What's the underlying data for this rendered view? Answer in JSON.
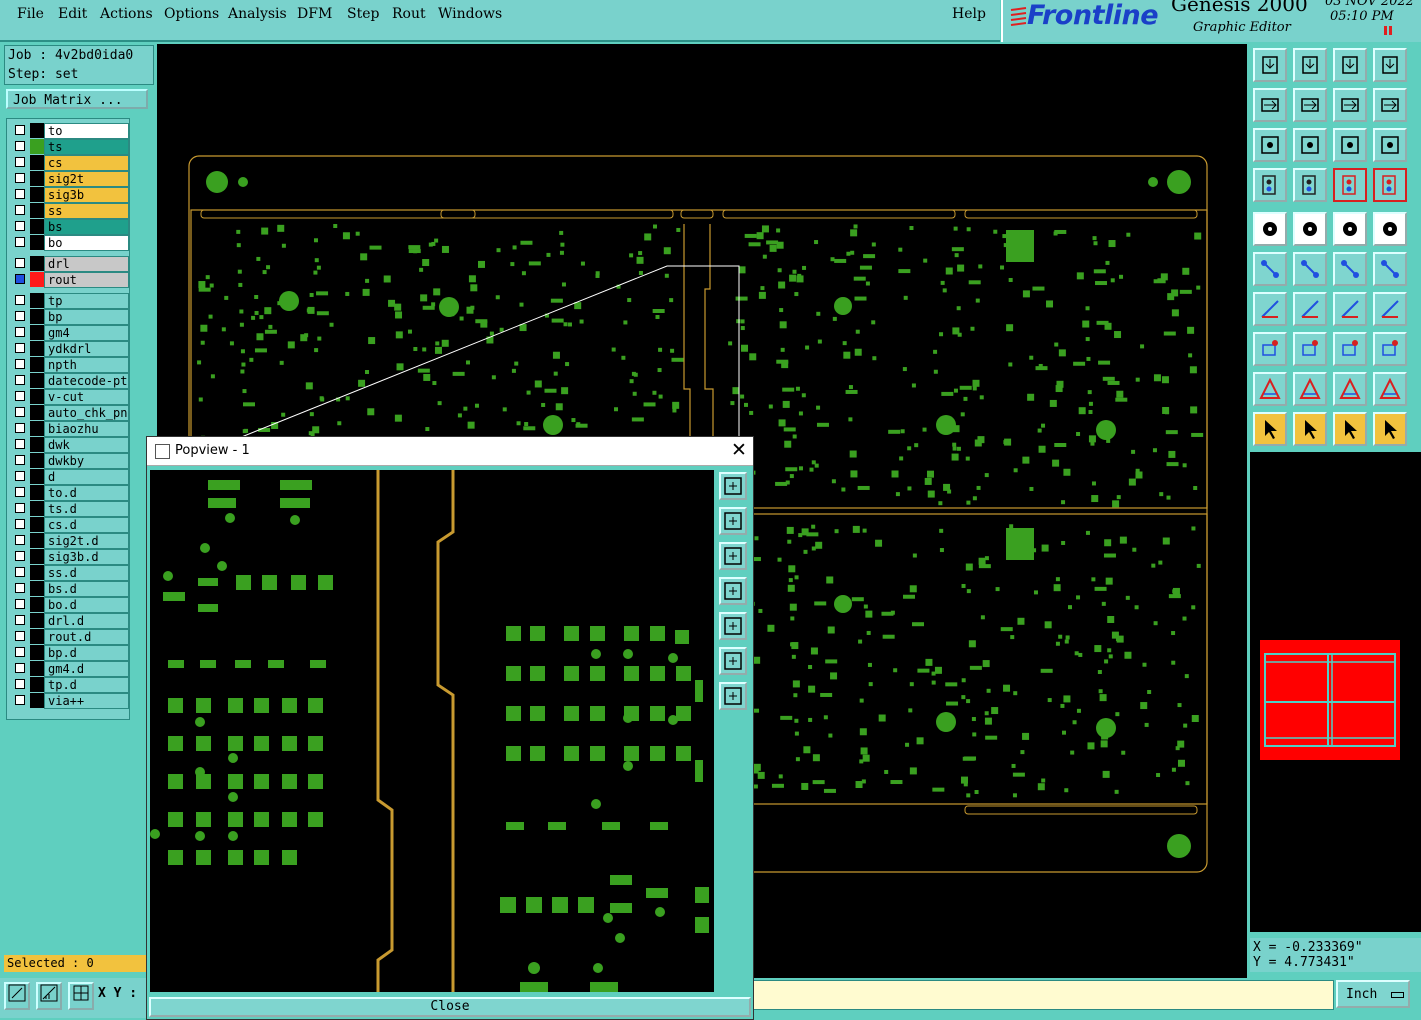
{
  "menu": {
    "items": [
      "File",
      "Edit",
      "Actions",
      "Options",
      "Analysis",
      "DFM",
      "Step",
      "Rout",
      "Windows"
    ],
    "help": "Help"
  },
  "brand": {
    "logo": "Frontline",
    "product": "Genesis 2000",
    "subtitle": "Graphic Editor",
    "date": "03 NOV 2022",
    "time": "05:10 PM"
  },
  "job": {
    "job_label": "Job : 4v2bd0ida0",
    "step_label": "Step: set",
    "matrix_button": "Job Matrix ..."
  },
  "layers": [
    {
      "name": "to",
      "color": "#ffffff",
      "swatch": "#000000"
    },
    {
      "name": "ts",
      "color": "#1fa08c",
      "swatch": "#3aa020"
    },
    {
      "name": "cs",
      "color": "#f2c23e",
      "swatch": "#000000"
    },
    {
      "name": "sig2t",
      "color": "#f2c23e",
      "swatch": "#000000"
    },
    {
      "name": "sig3b",
      "color": "#f2c23e",
      "swatch": "#000000"
    },
    {
      "name": "ss",
      "color": "#f2c23e",
      "swatch": "#000000"
    },
    {
      "name": "bs",
      "color": "#1fa08c",
      "swatch": "#000000"
    },
    {
      "name": "bo",
      "color": "#ffffff",
      "swatch": "#000000"
    },
    {
      "name": "drl",
      "color": "#c8c8c8",
      "swatch": "#000000"
    },
    {
      "name": "rout",
      "color": "#c8c8c8",
      "swatch": "#ff1a1a"
    },
    {
      "name": "tp",
      "color": "#79d2cc",
      "swatch": "#000000"
    },
    {
      "name": "bp",
      "color": "#79d2cc",
      "swatch": "#000000"
    },
    {
      "name": "gm4",
      "color": "#79d2cc",
      "swatch": "#000000"
    },
    {
      "name": "ydkdrl",
      "color": "#79d2cc",
      "swatch": "#000000"
    },
    {
      "name": "npth",
      "color": "#79d2cc",
      "swatch": "#000000"
    },
    {
      "name": "datecode-ptc",
      "color": "#79d2cc",
      "swatch": "#000000"
    },
    {
      "name": "v-cut",
      "color": "#79d2cc",
      "swatch": "#000000"
    },
    {
      "name": "auto_chk_pnl",
      "color": "#79d2cc",
      "swatch": "#000000"
    },
    {
      "name": "biaozhu",
      "color": "#79d2cc",
      "swatch": "#000000"
    },
    {
      "name": "dwk",
      "color": "#79d2cc",
      "swatch": "#000000"
    },
    {
      "name": "dwkby",
      "color": "#79d2cc",
      "swatch": "#000000"
    },
    {
      "name": "d",
      "color": "#79d2cc",
      "swatch": "#000000"
    },
    {
      "name": "to.d",
      "color": "#79d2cc",
      "swatch": "#000000"
    },
    {
      "name": "ts.d",
      "color": "#79d2cc",
      "swatch": "#000000"
    },
    {
      "name": "cs.d",
      "color": "#79d2cc",
      "swatch": "#000000"
    },
    {
      "name": "sig2t.d",
      "color": "#79d2cc",
      "swatch": "#000000"
    },
    {
      "name": "sig3b.d",
      "color": "#79d2cc",
      "swatch": "#000000"
    },
    {
      "name": "ss.d",
      "color": "#79d2cc",
      "swatch": "#000000"
    },
    {
      "name": "bs.d",
      "color": "#79d2cc",
      "swatch": "#000000"
    },
    {
      "name": "bo.d",
      "color": "#79d2cc",
      "swatch": "#000000"
    },
    {
      "name": "drl.d",
      "color": "#79d2cc",
      "swatch": "#000000"
    },
    {
      "name": "rout.d",
      "color": "#79d2cc",
      "swatch": "#000000"
    },
    {
      "name": "bp.d",
      "color": "#79d2cc",
      "swatch": "#000000"
    },
    {
      "name": "gm4.d",
      "color": "#79d2cc",
      "swatch": "#000000"
    },
    {
      "name": "tp.d",
      "color": "#79d2cc",
      "swatch": "#000000"
    },
    {
      "name": "via++",
      "color": "#79d2cc",
      "swatch": "#000000"
    }
  ],
  "status": {
    "selected": "Selected : 0",
    "xy_label": "X Y :",
    "x": "X = -0.233369\"",
    "y": "Y = 4.773431\"",
    "units": "Inch"
  },
  "popview": {
    "title": "Popview - 1",
    "close": "Close"
  },
  "colors": {
    "board_pad": "#3aa020",
    "profile": "#c89a30",
    "background": "#000000",
    "panel": "#79d2cc"
  }
}
